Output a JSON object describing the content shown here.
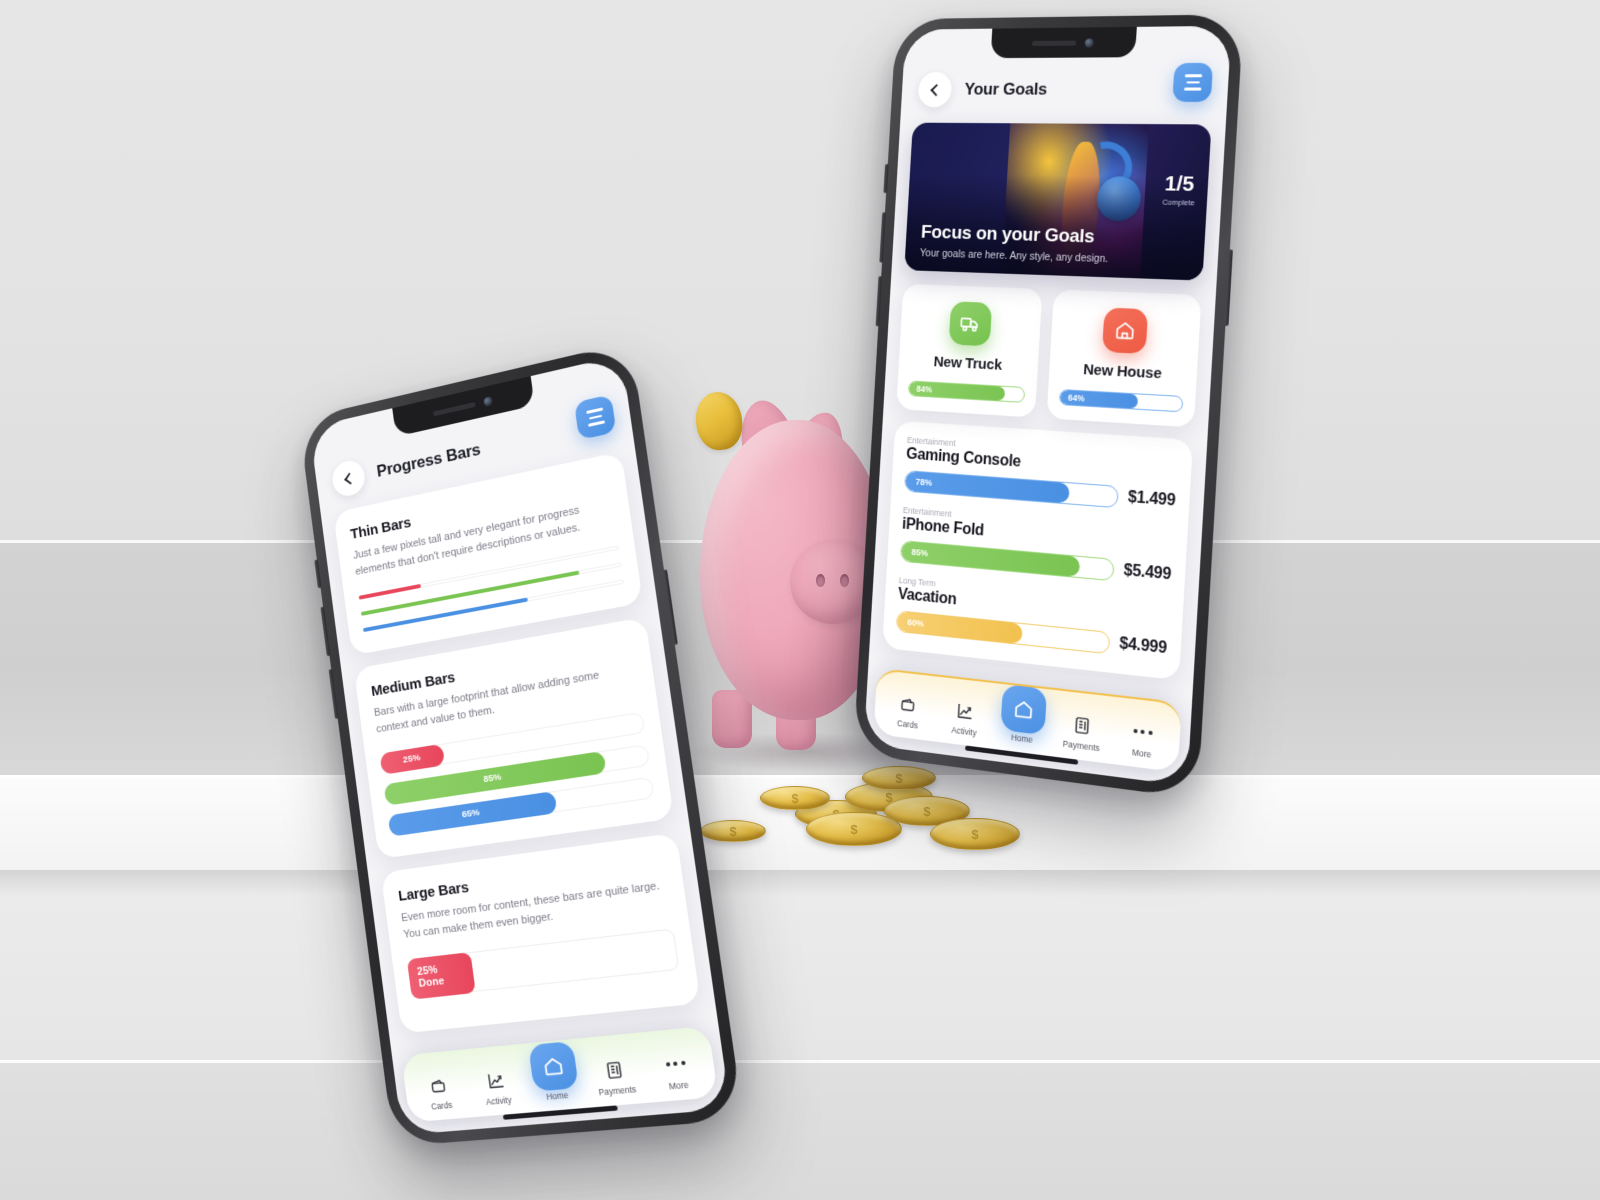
{
  "scene": {
    "background_color": "#e9e9e9",
    "props": [
      "piggy-bank",
      "gold-coins"
    ],
    "piggy_color": "#efaabb",
    "coin_color": "#e5bf4b"
  },
  "accent_colors": {
    "blue": "#4a90e2",
    "green": "#7ac452",
    "red": "#e8465c",
    "yellow": "#f2c14e",
    "orange_red": "#ee5a43"
  },
  "phone_right": {
    "header": {
      "back_icon": "chevron-left-icon",
      "title": "Your Goals",
      "menu_icon": "hamburger-menu-icon"
    },
    "banner": {
      "title": "Focus on your Goals",
      "subtitle": "Your goals are here. Any style, any design.",
      "count": "1/5",
      "count_label": "Complete"
    },
    "tiles": [
      {
        "icon": "truck-icon",
        "icon_color": "#76c24f",
        "name": "New Truck",
        "percent": 84,
        "percent_label": "84%",
        "bar_color": "green"
      },
      {
        "icon": "house-icon",
        "icon_color": "#ee5a43",
        "name": "New House",
        "percent": 64,
        "percent_label": "64%",
        "bar_color": "blue"
      }
    ],
    "goals": [
      {
        "category": "Entertainment",
        "name": "Gaming Console",
        "percent": 78,
        "percent_label": "78%",
        "amount": "$1.499",
        "bar_color": "blue"
      },
      {
        "category": "Entertainment",
        "name": "iPhone Fold",
        "percent": 85,
        "percent_label": "85%",
        "amount": "$5.499",
        "bar_color": "green"
      },
      {
        "category": "Long Term",
        "name": "Vacation",
        "percent": 60,
        "percent_label": "60%",
        "amount": "$4.999",
        "bar_color": "yellow"
      }
    ],
    "tabs": [
      {
        "label": "Cards",
        "icon": "wallet-icon"
      },
      {
        "label": "Activity",
        "icon": "chart-line-icon"
      },
      {
        "label": "Home",
        "icon": "home-icon",
        "active": true
      },
      {
        "label": "Payments",
        "icon": "bill-icon"
      },
      {
        "label": "More",
        "icon": "ellipsis-icon"
      }
    ]
  },
  "phone_left": {
    "header": {
      "back_icon": "chevron-left-icon",
      "title": "Progress Bars",
      "menu_icon": "hamburger-menu-icon"
    },
    "sections": [
      {
        "title": "Thin Bars",
        "description": "Just a few pixels tall and very elegant for progress elements that don't require descriptions or values.",
        "bars": [
          {
            "percent": 25,
            "color": "red"
          },
          {
            "percent": 85,
            "color": "green"
          },
          {
            "percent": 65,
            "color": "blue"
          }
        ]
      },
      {
        "title": "Medium Bars",
        "description": "Bars with a large footprint that allow adding some context and value to them.",
        "bars": [
          {
            "percent": 25,
            "label": "25%",
            "color": "red"
          },
          {
            "percent": 85,
            "label": "85%",
            "color": "green"
          },
          {
            "percent": 65,
            "label": "65%",
            "color": "blue"
          }
        ]
      },
      {
        "title": "Large Bars",
        "description": "Even more room for content, these bars are quite large. You can make them even bigger.",
        "bars": [
          {
            "percent": 25,
            "label_line1": "25%",
            "label_line2": "Done",
            "color": "red"
          }
        ]
      }
    ],
    "tabs": [
      {
        "label": "Cards",
        "icon": "wallet-icon"
      },
      {
        "label": "Activity",
        "icon": "chart-line-icon"
      },
      {
        "label": "Home",
        "icon": "home-icon",
        "active": true
      },
      {
        "label": "Payments",
        "icon": "bill-icon"
      },
      {
        "label": "More",
        "icon": "ellipsis-icon"
      }
    ]
  }
}
